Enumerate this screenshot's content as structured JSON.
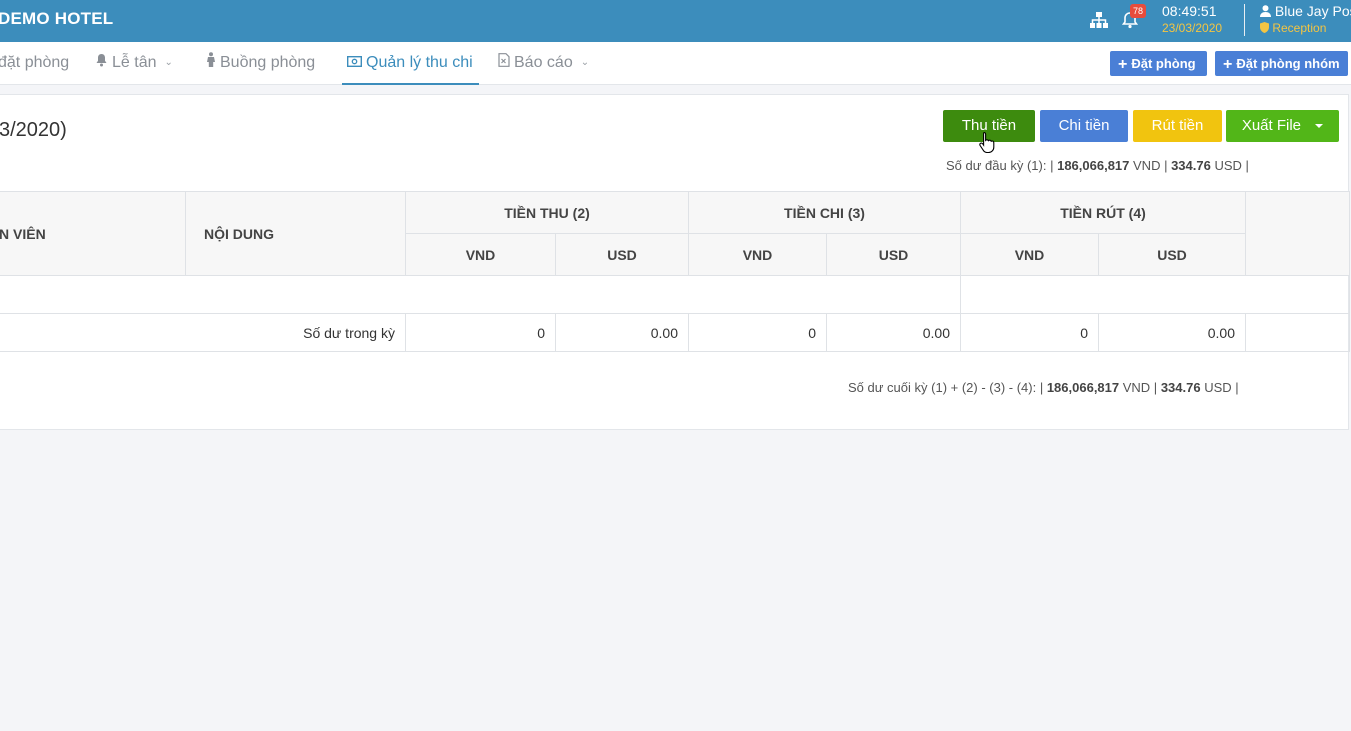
{
  "header": {
    "brand": "DEMO HOTEL",
    "notification_count": "78",
    "time": "08:49:51",
    "date": "23/03/2020",
    "user_name": "Blue Jay Pos",
    "role": "Reception",
    "icons": [
      "sitemap-icon",
      "bell-icon",
      "user-icon",
      "shield-icon"
    ],
    "colors": {
      "bar": "#3c8dbc",
      "accent": "#f4c542",
      "badge": "#e74c3c"
    }
  },
  "nav": {
    "items": [
      {
        "label": "đặt phòng"
      },
      {
        "label": "Lễ tân"
      },
      {
        "label": "Buồng phòng"
      },
      {
        "label": "Quản lý thu chi"
      },
      {
        "label": "Báo cáo"
      }
    ],
    "active": "Quản lý thu chi",
    "book_room_label": "Đặt phòng",
    "book_group_label": "Đặt phòng nhóm"
  },
  "panel": {
    "title": "3/2020)",
    "buttons": {
      "collect": "Thu tiền",
      "spend": "Chi tiền",
      "withdraw": "Rút tiền",
      "export": "Xuất File"
    },
    "opening": {
      "label": "Số dư đầu kỳ (1): |",
      "vnd": "186,066,817",
      "vnd_unit": "VND |",
      "usd": "334.76",
      "usd_unit": "USD |"
    },
    "closing": {
      "label": "Số dư cuối kỳ (1) + (2) - (3) - (4): |",
      "vnd": "186,066,817",
      "vnd_unit": "VND |",
      "usd": "334.76",
      "usd_unit": "USD |"
    }
  },
  "table": {
    "headers": {
      "staff": "N VIÊN",
      "content": "NỘI DUNG",
      "income": "TIỀN THU (2)",
      "expense": "TIỀN CHI (3)",
      "withdraw": "TIỀN RÚT (4)",
      "vnd": "VND",
      "usd": "USD"
    },
    "summary": {
      "label": "Số dư trong kỳ",
      "income_vnd": "0",
      "income_usd": "0.00",
      "expense_vnd": "0",
      "expense_usd": "0.00",
      "withdraw_vnd": "0",
      "withdraw_usd": "0.00"
    }
  }
}
